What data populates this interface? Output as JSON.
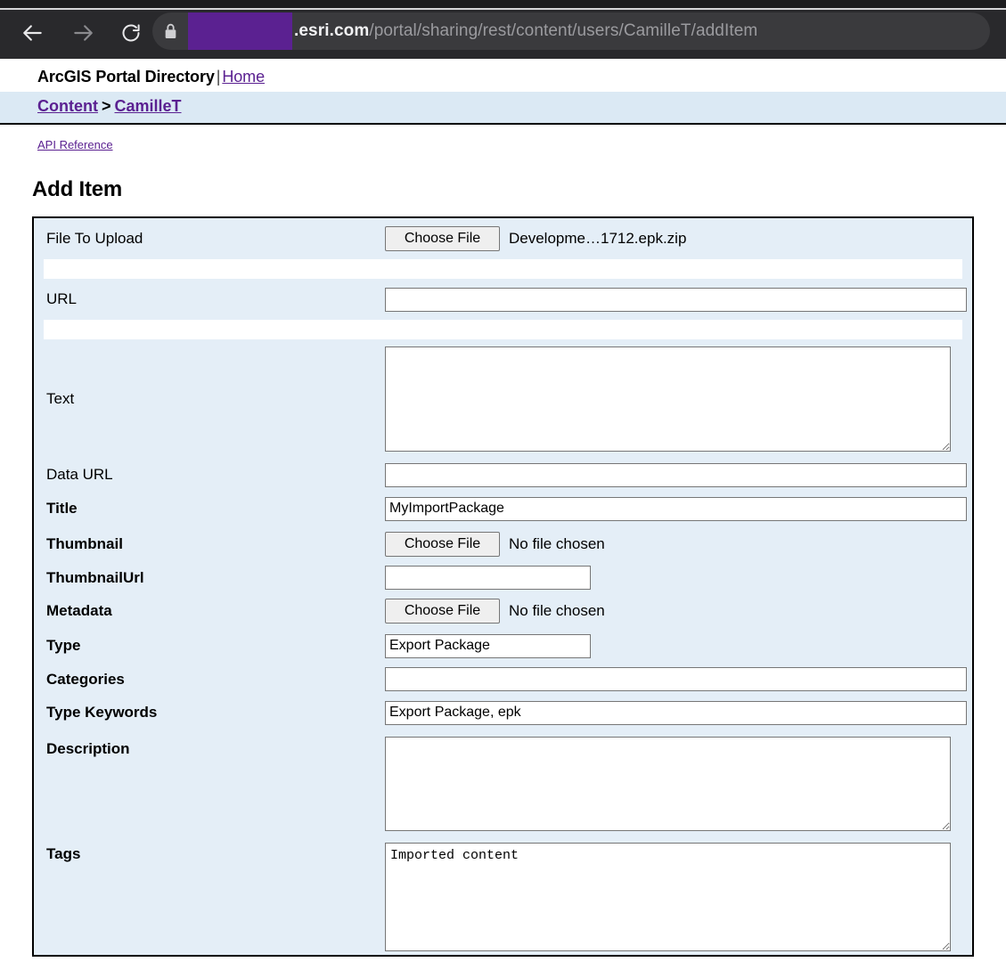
{
  "browser": {
    "back_icon": "arrow-left-icon",
    "forward_icon": "arrow-right-icon",
    "reload_icon": "reload-icon",
    "lock_icon": "lock-icon",
    "redaction_color": "#5b2191",
    "url_host": ".esri.com",
    "url_path": "/portal/sharing/rest/content/users/CamilleT/addItem"
  },
  "site": {
    "title": "ArcGIS Portal Directory",
    "separator": "|",
    "home_link": "Home",
    "breadcrumb": {
      "content": "Content",
      "gt": ">",
      "user": "CamilleT"
    },
    "api_reference": "API Reference"
  },
  "page": {
    "heading": "Add Item"
  },
  "form": {
    "choose_file_label": "Choose File",
    "no_file_chosen": "No file chosen",
    "rows": {
      "file_to_upload": {
        "label": "File To Upload",
        "bold": false,
        "file_name": "Developme…1712.epk.zip"
      },
      "url": {
        "label": "URL",
        "bold": false,
        "value": ""
      },
      "text": {
        "label": "Text",
        "bold": false,
        "value": ""
      },
      "data_url": {
        "label": "Data URL",
        "bold": false,
        "value": ""
      },
      "title": {
        "label": "Title",
        "bold": true,
        "value": "MyImportPackage"
      },
      "thumbnail": {
        "label": "Thumbnail",
        "bold": true,
        "file_name": "No file chosen"
      },
      "thumbnail_url": {
        "label": "ThumbnailUrl",
        "bold": true,
        "value": ""
      },
      "metadata": {
        "label": "Metadata",
        "bold": true,
        "file_name": "No file chosen"
      },
      "type": {
        "label": "Type",
        "bold": true,
        "value": "Export Package"
      },
      "categories": {
        "label": "Categories",
        "bold": true,
        "value": ""
      },
      "type_keywords": {
        "label": "Type Keywords",
        "bold": true,
        "value": "Export Package, epk"
      },
      "description": {
        "label": "Description",
        "bold": true,
        "value": ""
      },
      "tags": {
        "label": "Tags",
        "bold": true,
        "value": "Imported content"
      }
    }
  },
  "colors": {
    "chrome_bg": "#29292c",
    "row_bg": "#e4eef7",
    "breadcrumb_bg": "#dbe9f4",
    "link": "#5b2191"
  }
}
